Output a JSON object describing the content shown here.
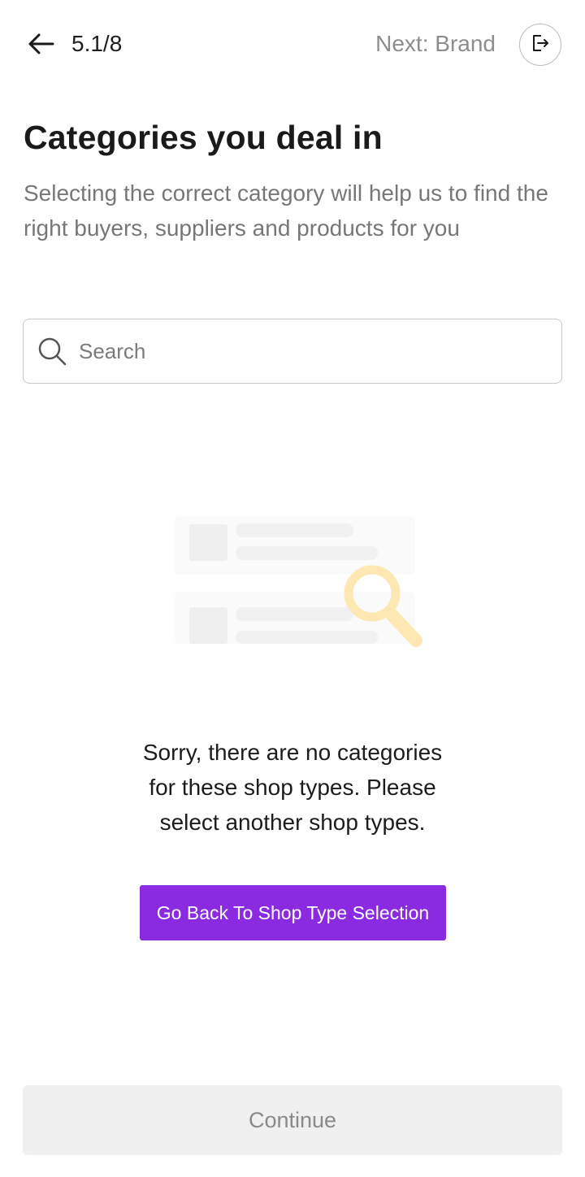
{
  "header": {
    "step": "5.1/8",
    "next": "Next: Brand",
    "back_icon": "arrow-left-icon",
    "exit_icon": "exit-icon"
  },
  "title": "Categories you deal in",
  "subtitle": "Selecting the correct category will help us to find the right buyers, suppliers and products for you",
  "search": {
    "placeholder": "Search",
    "value": "",
    "icon": "search-icon"
  },
  "empty_state": {
    "message": "Sorry, there are no categories for these shop types. Please select another shop types.",
    "button_label": "Go Back To Shop Type Selection",
    "illustration": "empty-search-illustration"
  },
  "footer": {
    "continue_label": "Continue"
  },
  "colors": {
    "accent": "#8a2be2",
    "muted_text": "#8d8d8d",
    "disabled_bg": "#f0f0f0",
    "magnifier": "#fde7b3"
  }
}
